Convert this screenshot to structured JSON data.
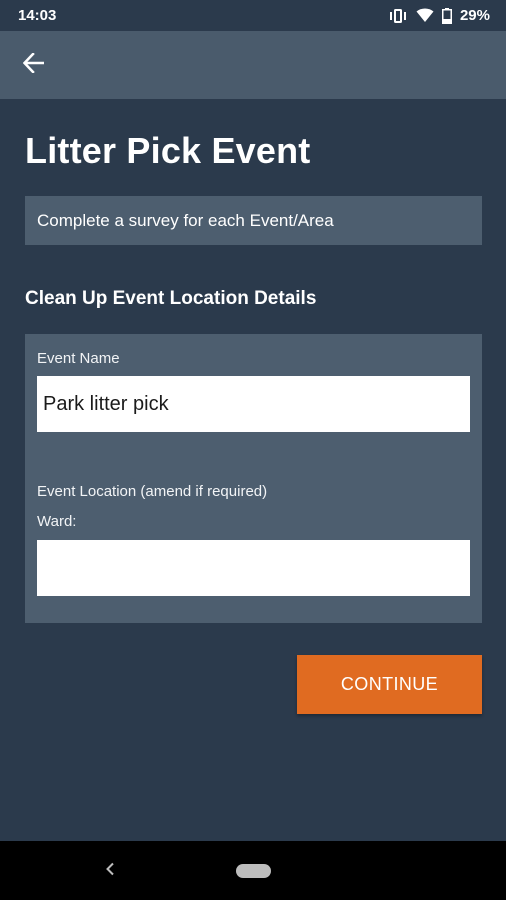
{
  "status_bar": {
    "time": "14:03",
    "battery": "29%",
    "icons": [
      "vibrate-icon",
      "wifi-icon",
      "battery-icon"
    ]
  },
  "app_bar": {
    "back_icon": "arrow-left-icon"
  },
  "page": {
    "title": "Litter Pick Event",
    "info": "Complete a survey for each Event/Area",
    "section_heading": "Clean Up Event Location Details"
  },
  "form": {
    "event_name_label": "Event Name",
    "event_name_value": "Park litter pick",
    "location_label": "Event Location (amend if required)",
    "ward_label": "Ward:",
    "ward_value": ""
  },
  "actions": {
    "continue_label": "CONTINUE"
  },
  "colors": {
    "background": "#2b3a4c",
    "app_bar": "#4a5b6c",
    "card": "#4d5e6f",
    "accent": "#e06b21"
  },
  "nav_bar": {
    "icons": [
      "nav-back-icon",
      "nav-home-pill"
    ]
  }
}
